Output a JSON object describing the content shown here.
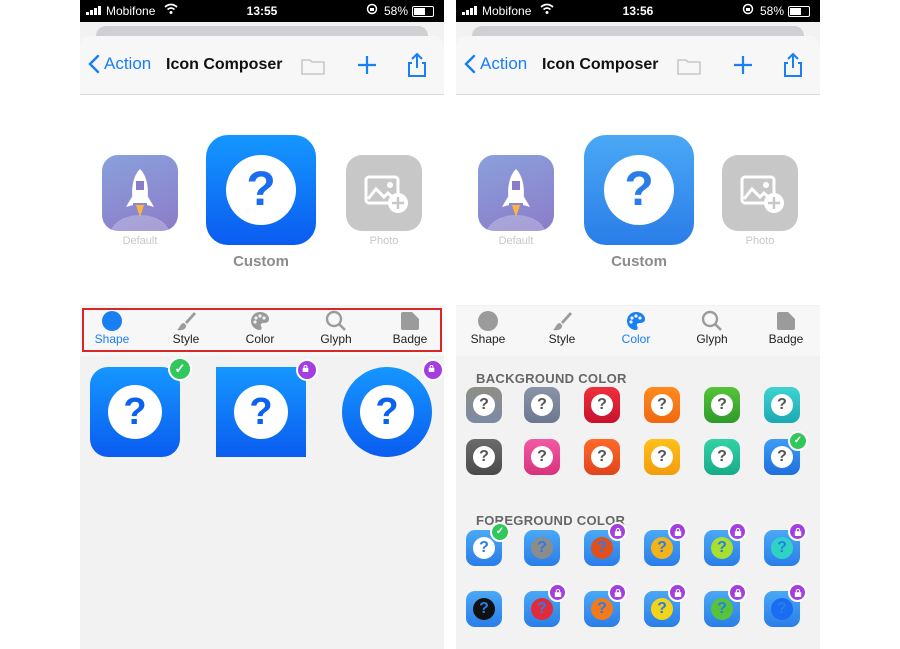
{
  "status": {
    "carrier": "Mobifone",
    "battery": "58%",
    "time_left": "13:55",
    "time_right": "13:56"
  },
  "nav": {
    "back_label": "Action",
    "title": "Icon Composer"
  },
  "preview": {
    "default_label": "Default",
    "custom_label": "Custom",
    "photo_label": "Photo"
  },
  "tabs": [
    {
      "label": "Shape",
      "icon": "circle-icon"
    },
    {
      "label": "Style",
      "icon": "brush-icon"
    },
    {
      "label": "Color",
      "icon": "palette-icon"
    },
    {
      "label": "Glyph",
      "icon": "search-icon"
    },
    {
      "label": "Badge",
      "icon": "badge-icon"
    }
  ],
  "left": {
    "active_tab": "Shape",
    "shapes": [
      {
        "name": "rounded",
        "selected": true,
        "locked": false
      },
      {
        "name": "square",
        "selected": false,
        "locked": true
      },
      {
        "name": "circle",
        "selected": false,
        "locked": true
      }
    ]
  },
  "right": {
    "active_tab": "Color",
    "background_title": "BACKGROUND COLOR",
    "foreground_title": "FOREGROUND COLOR",
    "background_colors": [
      [
        "#8f8f86",
        "#7b8aa3"
      ],
      [
        "#8a94a8",
        "#6c7890"
      ],
      [
        "#ef2f3c",
        "#c8102e"
      ],
      [
        "#ff8a1f",
        "#f06810"
      ],
      [
        "#55c43a",
        "#2f9a2a"
      ],
      [
        "#3fd3d0",
        "#1aa9b4"
      ],
      [
        "#6b6b6b",
        "#4a4a4a"
      ],
      [
        "#f25aa3",
        "#d8327e"
      ],
      [
        "#ff6a2a",
        "#e0441b"
      ],
      [
        "#ffbf1a",
        "#f29d0b"
      ],
      [
        "#33d2a8",
        "#17ac86"
      ],
      [
        "#3d9cf5",
        "#1f6fdc"
      ]
    ],
    "background_selected": 11,
    "foreground_colors": [
      "#ffffff",
      "#8c8c8c",
      "#e0501c",
      "#f2b418",
      "#a8e030",
      "#2fd3c4",
      "#111111",
      "#e32a3a",
      "#f27a1a",
      "#f2d418",
      "#55c43a",
      "#1a6cf0"
    ],
    "foreground_selected": 0
  },
  "colors": {
    "accent": "#1a7ef5",
    "highlight": "#d62828",
    "check": "#31c75a",
    "lock": "#a43ee0"
  }
}
